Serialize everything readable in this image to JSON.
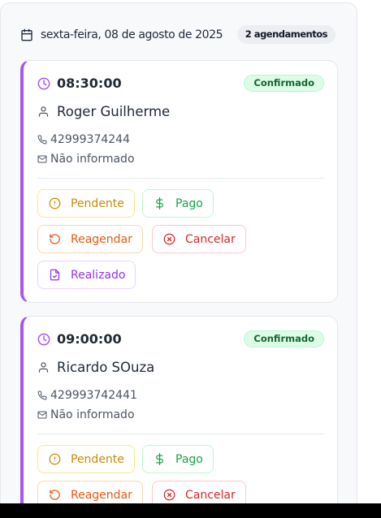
{
  "day": {
    "date": "sexta-feira, 08 de agosto de 2025",
    "count": "2 agendamentos",
    "icon": "calendar-icon"
  },
  "colors": {
    "accent": "#a855f7",
    "confirmed_bg": "#dcfce7",
    "pending": "#ca8a04",
    "paid": "#16a34a",
    "reschedule": "#ea580c",
    "cancel": "#dc2626",
    "done": "#9333ea"
  },
  "appointments": [
    {
      "time": "08:30:00",
      "status": "Confirmado",
      "name": "Roger Guilherme",
      "phone": "42999374244",
      "email": "Não informado",
      "actions": {
        "pending": "Pendente",
        "paid": "Pago",
        "reschedule": "Reagendar",
        "cancel": "Cancelar",
        "done": "Realizado"
      }
    },
    {
      "time": "09:00:00",
      "status": "Confirmado",
      "name": "Ricardo SOuza",
      "phone": "429993742441",
      "email": "Não informado",
      "actions": {
        "pending": "Pendente",
        "paid": "Pago",
        "reschedule": "Reagendar",
        "cancel": "Cancelar"
      }
    }
  ]
}
